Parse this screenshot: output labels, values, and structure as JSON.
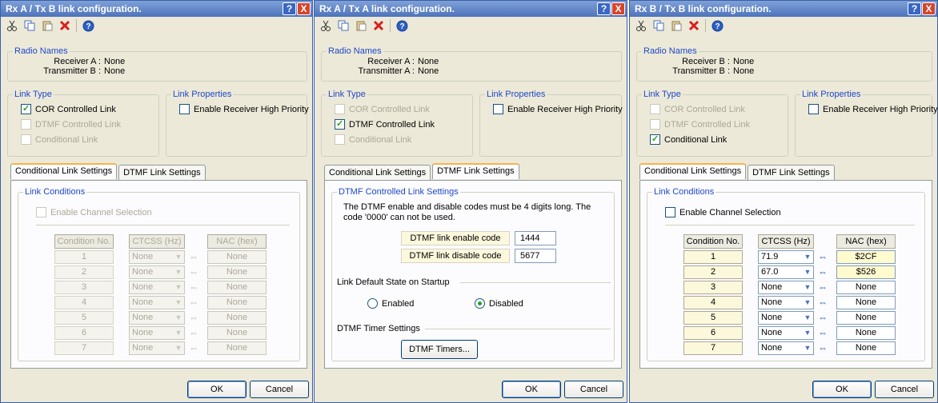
{
  "common": {
    "radio_names_legend": "Radio Names",
    "link_type_legend": "Link Type",
    "link_properties_legend": "Link Properties",
    "cor_label": "COR Controlled Link",
    "dtmf_label": "DTMF Controlled Link",
    "conditional_label": "Conditional Link",
    "enable_priority_label": "Enable Receiver High Priority",
    "tab_conditional": "Conditional Link Settings",
    "tab_dtmf": "DTMF Link Settings",
    "link_conditions_legend": "Link Conditions",
    "enable_channel_label": "Enable Channel Selection",
    "col_condition": "Condition No.",
    "col_ctcss": "CTCSS (Hz)",
    "col_nac": "NAC (hex)",
    "ok_label": "OK",
    "cancel_label": "Cancel",
    "help_glyph": "?",
    "close_glyph": "X",
    "swap_glyph": "⇔",
    "dropdown_glyph": "▼"
  },
  "dialogs": [
    {
      "title": "Rx A / Tx B link configuration.",
      "radio_names": [
        {
          "label": "Receiver A :",
          "value": "None"
        },
        {
          "label": "Transmitter B :",
          "value": "None"
        }
      ],
      "cor_checked": true,
      "dtmf_checked": false,
      "conditional_checked": false,
      "priority_checked": false,
      "active_tab": "conditional",
      "table_enabled": false,
      "rows": [
        {
          "no": "1",
          "ctcss": "None",
          "nac": "None"
        },
        {
          "no": "2",
          "ctcss": "None",
          "nac": "None"
        },
        {
          "no": "3",
          "ctcss": "None",
          "nac": "None"
        },
        {
          "no": "4",
          "ctcss": "None",
          "nac": "None"
        },
        {
          "no": "5",
          "ctcss": "None",
          "nac": "None"
        },
        {
          "no": "6",
          "ctcss": "None",
          "nac": "None"
        },
        {
          "no": "7",
          "ctcss": "None",
          "nac": "None"
        }
      ]
    },
    {
      "title": "Rx A / Tx A link configuration.",
      "radio_names": [
        {
          "label": "Receiver A :",
          "value": "None"
        },
        {
          "label": "Transmitter A :",
          "value": "None"
        }
      ],
      "cor_checked": false,
      "dtmf_checked": true,
      "conditional_checked": false,
      "priority_checked": false,
      "active_tab": "dtmf",
      "dtmf_settings": {
        "legend": "DTMF Controlled Link Settings",
        "note_line1": "The DTMF enable and disable codes must be 4 digits long. The",
        "note_line2": "code '0000' can not be used.",
        "enable_code_label": "DTMF link enable code",
        "enable_code_value": "1444",
        "disable_code_label": "DTMF link disable code",
        "disable_code_value": "5677",
        "default_state_label": "Link Default State on Startup",
        "enabled_label": "Enabled",
        "disabled_label": "Disabled",
        "selected_state": "Disabled",
        "timer_label": "DTMF Timer Settings",
        "timers_button": "DTMF Timers..."
      }
    },
    {
      "title": "Rx B / Tx B link configuration.",
      "radio_names": [
        {
          "label": "Receiver B :",
          "value": "None"
        },
        {
          "label": "Transmitter B :",
          "value": "None"
        }
      ],
      "cor_checked": false,
      "dtmf_checked": false,
      "conditional_checked": true,
      "priority_checked": false,
      "active_tab": "conditional",
      "table_enabled": true,
      "rows": [
        {
          "no": "1",
          "ctcss": "71.9",
          "nac": "$2CF"
        },
        {
          "no": "2",
          "ctcss": "67.0",
          "nac": "$526"
        },
        {
          "no": "3",
          "ctcss": "None",
          "nac": "None"
        },
        {
          "no": "4",
          "ctcss": "None",
          "nac": "None"
        },
        {
          "no": "5",
          "ctcss": "None",
          "nac": "None"
        },
        {
          "no": "6",
          "ctcss": "None",
          "nac": "None"
        },
        {
          "no": "7",
          "ctcss": "None",
          "nac": "None"
        }
      ]
    }
  ]
}
